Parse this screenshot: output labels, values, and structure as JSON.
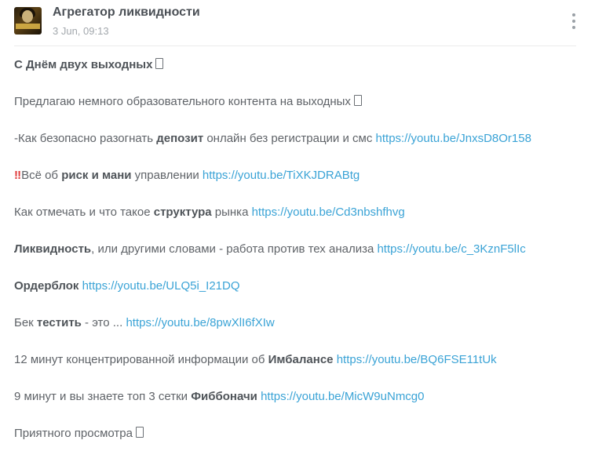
{
  "header": {
    "channel_name": "Агрегатор ликвидности",
    "timestamp": "3 Jun, 09:13",
    "avatar_icon": "channel-avatar",
    "menu_icon": "more-vertical-icon"
  },
  "post": {
    "l1_text": "С Днём двух выходных",
    "l2_text": "Предлагаю немного образовательного контента на выходных",
    "l3_a": "-Как безопасно разогнать ",
    "l3_b": "депозит",
    "l3_c": " онлайн без регистрации и смс ",
    "l3_link": "https://youtu.be/JnxsD8Or158",
    "l4_prefix": "‼",
    "l4_a": "Всё об ",
    "l4_b": "риск и мани",
    "l4_c": " управлении ",
    "l4_link": "https://youtu.be/TiXKJDRABtg",
    "l5_a": "Как отмечать и что такое ",
    "l5_b": "структура",
    "l5_c": " рынка ",
    "l5_link": "https://youtu.be/Cd3nbshfhvg",
    "l6_b": "Ликвидность",
    "l6_c": ", или другими словами - работа против тех анализа ",
    "l6_link": "https://youtu.be/c_3KznF5lIc",
    "l7_b": "Ордерблок",
    "l7_link": "https://youtu.be/ULQ5i_I21DQ",
    "l8_a": "Бек ",
    "l8_b": "тестить",
    "l8_c": " - это ... ",
    "l8_link": "https://youtu.be/8pwXlI6fXIw",
    "l9_a": "12 минут концентрированной информации об ",
    "l9_b": "Имбалансе",
    "l9_link": "https://youtu.be/BQ6FSE11tUk",
    "l10_a": "9 минут и вы знаете топ 3 сетки ",
    "l10_b": "Фиббоначи",
    "l10_link": "https://youtu.be/MicW9uNmcg0",
    "l11_text": "Приятного просмотра"
  },
  "colors": {
    "link": "#3aa3d6",
    "text": "#5f6368",
    "bold": "#4f5459",
    "timestamp": "#a3a8ad"
  }
}
